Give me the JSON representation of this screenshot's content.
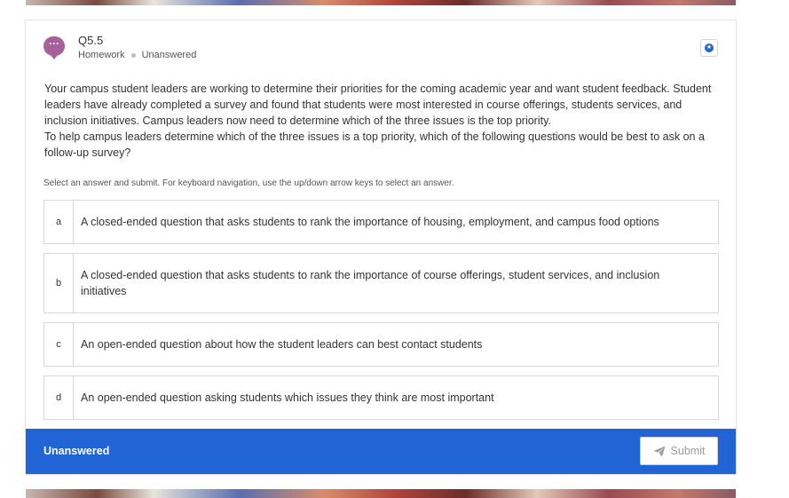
{
  "question": {
    "number": "Q5.5",
    "meta_type": "Homework",
    "meta_status": "Unanswered",
    "icon": "chat-bubble-icon",
    "paragraphs": [
      "Your campus student leaders are working to determine their priorities for the coming academic year and want student feedback. Student leaders have already completed a survey and found that students were most interested in course offerings, students services, and inclusion initiatives. Campus leaders now need to determine which of the three issues is the top priority.",
      "To help campus leaders determine which of the three issues is a top priority, which of the following questions would be best to ask on a follow-up survey?"
    ],
    "instructions": "Select an answer and submit. For keyboard navigation, use the up/down arrow keys to select an answer."
  },
  "options": [
    {
      "letter": "a",
      "text": "A closed-ended question that asks students to rank the importance of housing, employment, and campus food options"
    },
    {
      "letter": "b",
      "text": "A closed-ended question that asks students to rank the importance of course offerings, student services, and inclusion initiatives"
    },
    {
      "letter": "c",
      "text": "An open-ended question about how the student leaders can best contact students"
    },
    {
      "letter": "d",
      "text": "An open-ended question asking students which issues they think are most important"
    }
  ],
  "footer": {
    "status": "Unanswered",
    "submit_label": "Submit",
    "submit_icon": "paper-plane-icon",
    "bar_color": "#2064d5"
  },
  "colors": {
    "accent": "#1f66d6",
    "question_icon": "#a8609b"
  }
}
